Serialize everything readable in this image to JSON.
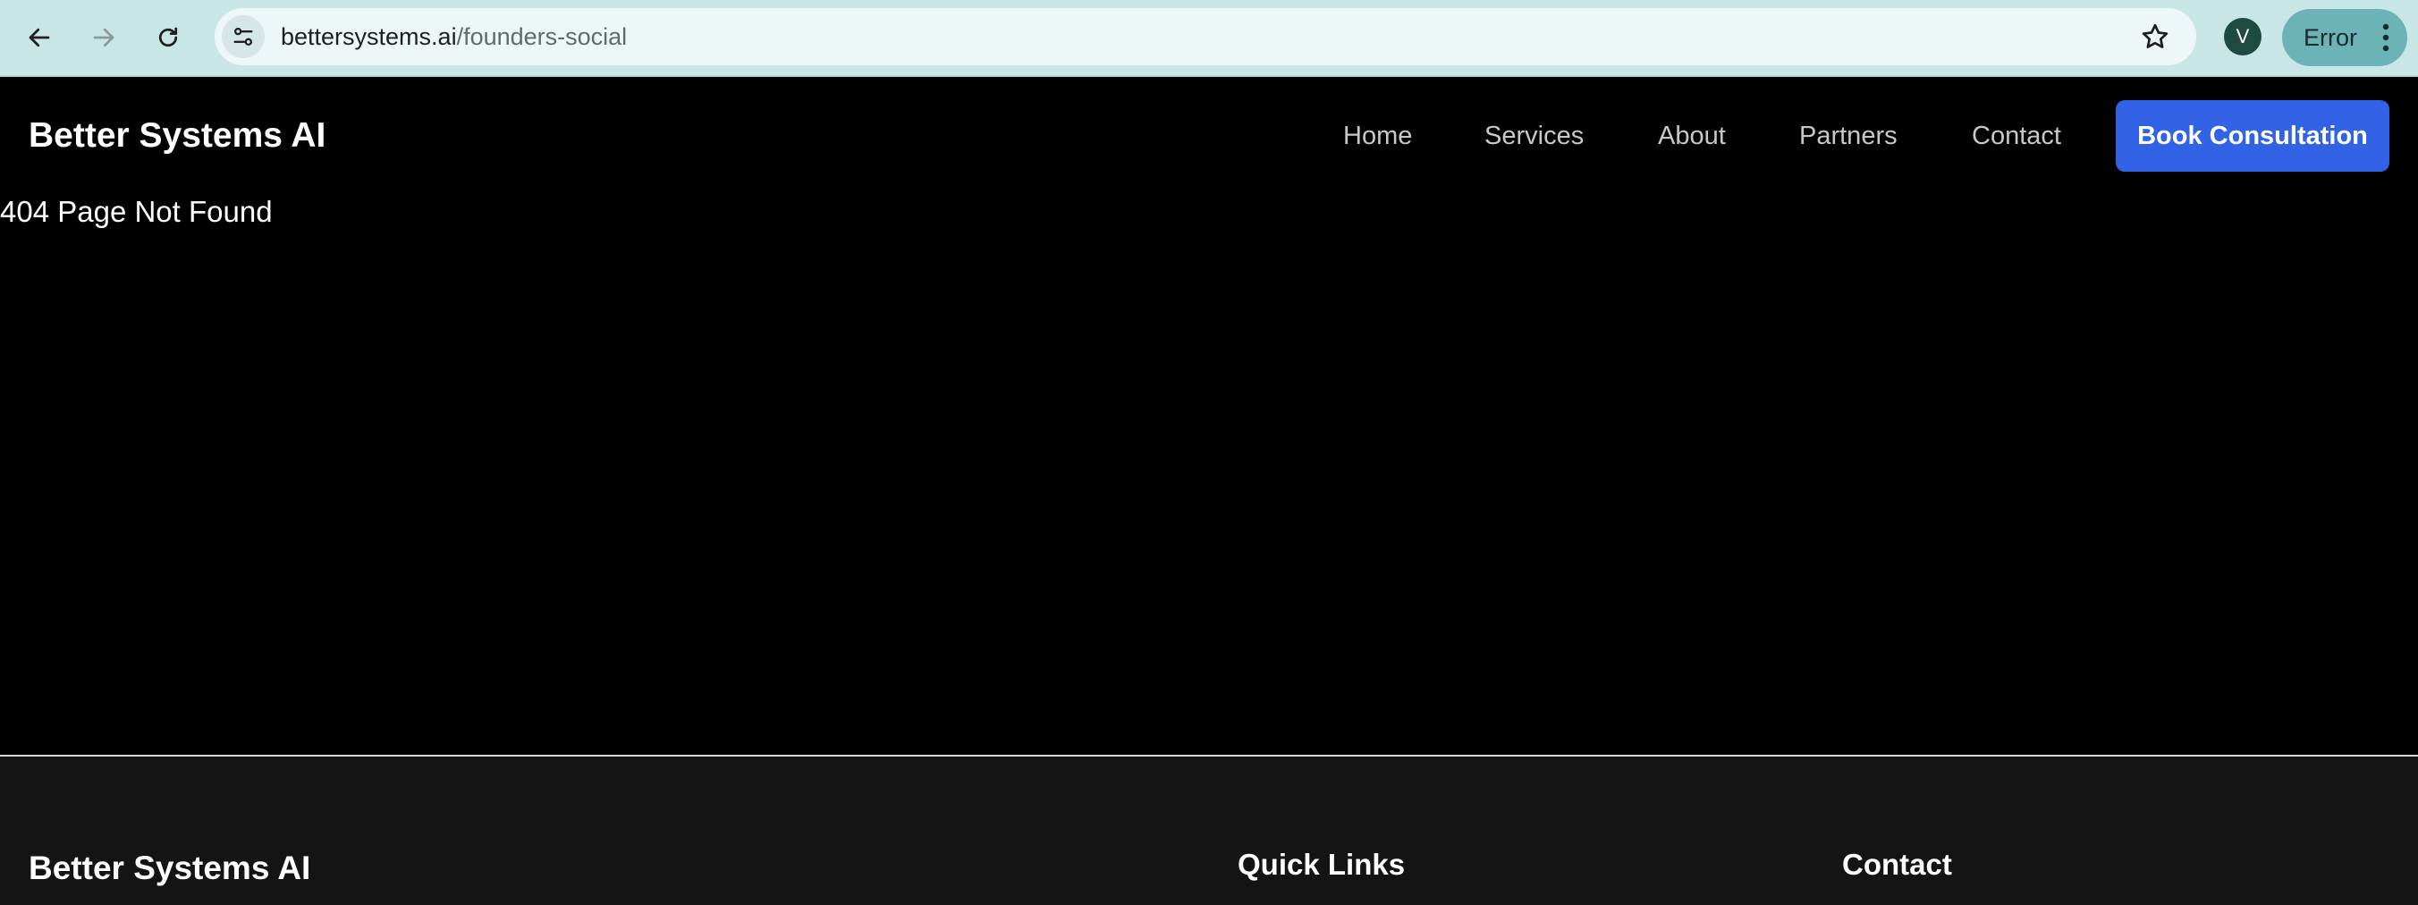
{
  "browser": {
    "url_host": "bettersystems.ai",
    "url_path": "/founders-social",
    "profile_initial": "V",
    "status_label": "Error",
    "icons": [
      "back-arrow-icon",
      "forward-arrow-icon",
      "reload-icon",
      "site-info-icon",
      "bookmark-star-icon",
      "more-vert-icon"
    ]
  },
  "header": {
    "brand": "Better Systems AI",
    "nav": [
      {
        "label": "Home"
      },
      {
        "label": "Services"
      },
      {
        "label": "About"
      },
      {
        "label": "Partners"
      },
      {
        "label": "Contact"
      }
    ],
    "cta_label": "Book Consultation"
  },
  "main": {
    "message": "404 Page Not Found"
  },
  "footer": {
    "brand": "Better Systems AI",
    "quick_links_heading": "Quick Links",
    "contact_heading": "Contact"
  },
  "colors": {
    "chrome_bg": "#c9e6e6",
    "page_bg": "#000000",
    "footer_bg": "#141414",
    "cta_bg": "#3263e6",
    "nav_text": "#c8c8c8",
    "error_pill": "#6cb3b8"
  }
}
